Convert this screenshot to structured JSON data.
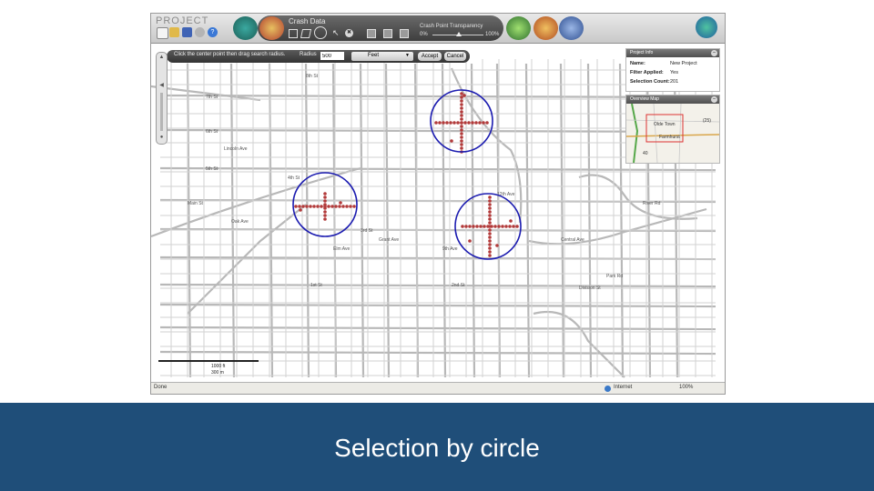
{
  "app": {
    "title": "PROJECT"
  },
  "toolbar": {
    "panel_title": "Crash Data",
    "transparency_label": "Crash Point Transparency",
    "transparency_min": "0%",
    "transparency_max": "100%",
    "small_icons": [
      "new-icon",
      "open-icon",
      "save-icon",
      "settings-icon",
      "help-icon"
    ],
    "big_icons": [
      "layers-icon",
      "crash-data-icon",
      "charts-icon",
      "report-icon",
      "calculator-icon"
    ],
    "select_tools": [
      "rectangle-select-icon",
      "polygon-select-icon",
      "circle-select-icon",
      "pointer-icon",
      "clear-icon",
      "table-icon",
      "export-icon",
      "grid-icon"
    ]
  },
  "search": {
    "message": "Click the center point then drag search radius.",
    "radius_label": "Radius",
    "radius_value": "500",
    "unit": "Feet",
    "accept_label": "Accept",
    "cancel_label": "Cancel"
  },
  "project_info": {
    "title": "Project Info",
    "rows": [
      {
        "label": "Name:",
        "value": "New Project"
      },
      {
        "label": "Filter Applied:",
        "value": "Yes"
      },
      {
        "label": "Selection Count:",
        "value": "201"
      }
    ]
  },
  "overview": {
    "title": "Overview Map",
    "labels": [
      "Olde Town",
      "Farmhurst"
    ],
    "badges": [
      "(25)",
      "40"
    ]
  },
  "map": {
    "street_labels": [
      "8th St",
      "7th St",
      "6th St",
      "5th St",
      "4th St",
      "3rd St",
      "2nd St",
      "1st St",
      "Division St",
      "Main St",
      "Oak Ave",
      "Elm Ave",
      "Grant Ave",
      "9th Ave",
      "12th Ave",
      "Central Ave",
      "Park Rd",
      "River Rd",
      "Lincoln Ave"
    ],
    "scale_labels": [
      "1000 ft",
      "300 m"
    ]
  },
  "status": {
    "left": "Done",
    "zone": "Internet",
    "zoom": "100%"
  },
  "caption": "Selection by circle",
  "colors": {
    "selection_circle": "#1c1cb0",
    "crash_point": "#b23a3a",
    "caption_band": "#1f4e79"
  }
}
